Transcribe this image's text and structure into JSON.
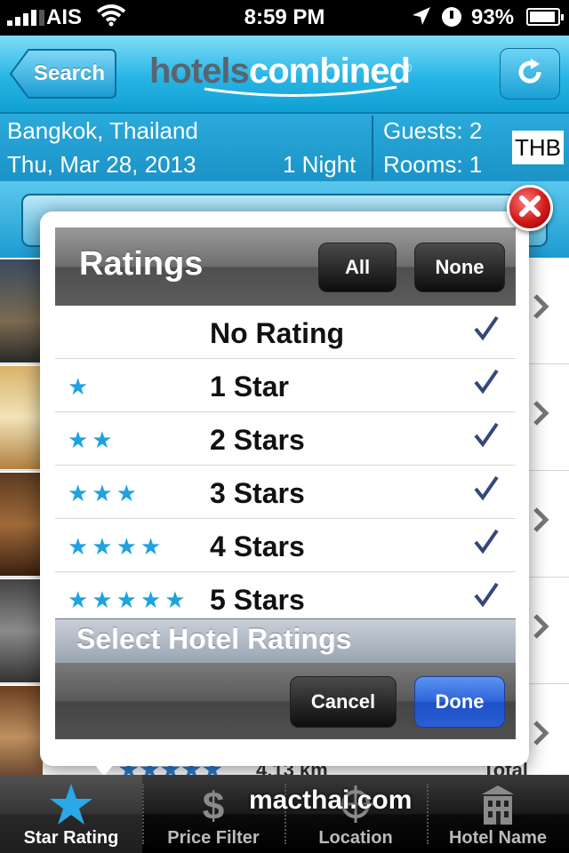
{
  "status_bar": {
    "carrier": "AIS",
    "time": "8:59 PM",
    "battery": "93%"
  },
  "navbar": {
    "back_label": "Search",
    "logo_part1": "hotels",
    "logo_part2": "combined",
    "logo_mark": "®"
  },
  "search": {
    "city": "Bangkok, Thailand",
    "date": "Thu, Mar 28, 2013",
    "nights": "1 Night",
    "guests": "Guests: 2",
    "rooms": "Rooms: 1",
    "currency": "THB"
  },
  "ratings_picker": {
    "title": "Ratings",
    "all_label": "All",
    "none_label": "None",
    "items": [
      {
        "stars": "",
        "label": "No Rating",
        "checked": true
      },
      {
        "stars": "★",
        "label": "1 Star",
        "checked": true
      },
      {
        "stars": "★★",
        "label": "2 Stars",
        "checked": true
      },
      {
        "stars": "★★★",
        "label": "3 Stars",
        "checked": true
      },
      {
        "stars": "★★★★",
        "label": "4 Stars",
        "checked": true
      },
      {
        "stars": "★★★★★",
        "label": "5 Stars",
        "checked": true
      }
    ],
    "subtitle": "Select Hotel Ratings",
    "cancel_label": "Cancel",
    "done_label": "Done"
  },
  "list_peek": {
    "stars": "★★★★★",
    "distance": "4.13 km",
    "total": "Total"
  },
  "tabbar": {
    "tabs": [
      {
        "label": "Star Rating",
        "icon": "star-icon",
        "active": true
      },
      {
        "label": "Price Filter",
        "icon": "dollar-icon",
        "active": false
      },
      {
        "label": "Location",
        "icon": "location-icon",
        "active": false
      },
      {
        "label": "Hotel Name",
        "icon": "building-icon",
        "active": false
      }
    ],
    "watermark": "macthai.com"
  },
  "colors": {
    "accent": "#1ea3e0",
    "done": "#2d62d9",
    "close": "#d11a1a"
  }
}
